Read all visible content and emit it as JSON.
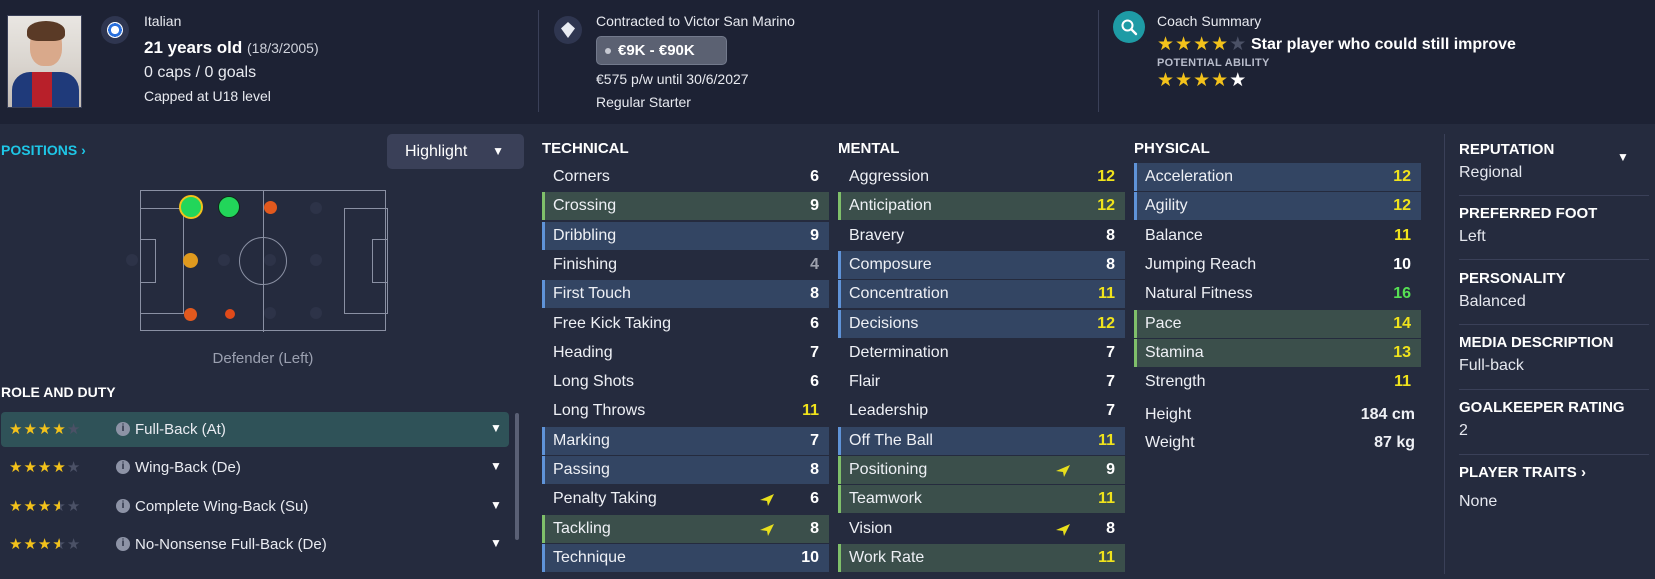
{
  "header": {
    "nationality": "Italian",
    "age": "21 years old",
    "dob": "(18/3/2005)",
    "caps": "0 caps / 0 goals",
    "capped_level": "Capped at U18 level",
    "contract_club": "Contracted to Victor San Marino",
    "wage_range": "€9K - €90K",
    "wage_detail": "€575 p/w until 30/6/2027",
    "squad_status": "Regular Starter",
    "coach_summary_title": "Coach Summary",
    "coach_summary_text": "Star player who could still improve",
    "current_ability_stars": 4,
    "potential_label": "POTENTIAL ABILITY",
    "potential_ability_stars": 4.5
  },
  "positions": {
    "link_label": "POSITIONS",
    "highlight_label": "Highlight",
    "caption": "Defender (Left)"
  },
  "roles": {
    "title": "ROLE AND DUTY",
    "items": [
      {
        "name": "Full-Back (At)",
        "stars": 4
      },
      {
        "name": "Wing-Back (De)",
        "stars": 4
      },
      {
        "name": "Complete Wing-Back (Su)",
        "stars": 3.5
      },
      {
        "name": "No-Nonsense Full-Back (De)",
        "stars": 3.5
      }
    ]
  },
  "technical": {
    "title": "TECHNICAL",
    "items": [
      {
        "name": "Corners",
        "value": "6"
      },
      {
        "name": "Crossing",
        "value": "9"
      },
      {
        "name": "Dribbling",
        "value": "9"
      },
      {
        "name": "Finishing",
        "value": "4"
      },
      {
        "name": "First Touch",
        "value": "8"
      },
      {
        "name": "Free Kick Taking",
        "value": "6"
      },
      {
        "name": "Heading",
        "value": "7"
      },
      {
        "name": "Long Shots",
        "value": "6"
      },
      {
        "name": "Long Throws",
        "value": "11"
      },
      {
        "name": "Marking",
        "value": "7"
      },
      {
        "name": "Passing",
        "value": "8"
      },
      {
        "name": "Penalty Taking",
        "value": "6"
      },
      {
        "name": "Tackling",
        "value": "8"
      },
      {
        "name": "Technique",
        "value": "10"
      }
    ]
  },
  "mental": {
    "title": "MENTAL",
    "items": [
      {
        "name": "Aggression",
        "value": "12"
      },
      {
        "name": "Anticipation",
        "value": "12"
      },
      {
        "name": "Bravery",
        "value": "8"
      },
      {
        "name": "Composure",
        "value": "8"
      },
      {
        "name": "Concentration",
        "value": "11"
      },
      {
        "name": "Decisions",
        "value": "12"
      },
      {
        "name": "Determination",
        "value": "7"
      },
      {
        "name": "Flair",
        "value": "7"
      },
      {
        "name": "Leadership",
        "value": "7"
      },
      {
        "name": "Off The Ball",
        "value": "11"
      },
      {
        "name": "Positioning",
        "value": "9"
      },
      {
        "name": "Teamwork",
        "value": "11"
      },
      {
        "name": "Vision",
        "value": "8"
      },
      {
        "name": "Work Rate",
        "value": "11"
      }
    ]
  },
  "physical": {
    "title": "PHYSICAL",
    "items": [
      {
        "name": "Acceleration",
        "value": "12"
      },
      {
        "name": "Agility",
        "value": "12"
      },
      {
        "name": "Balance",
        "value": "11"
      },
      {
        "name": "Jumping Reach",
        "value": "10"
      },
      {
        "name": "Natural Fitness",
        "value": "16"
      },
      {
        "name": "Pace",
        "value": "14"
      },
      {
        "name": "Stamina",
        "value": "13"
      },
      {
        "name": "Strength",
        "value": "11"
      }
    ],
    "height_label": "Height",
    "height_value": "184 cm",
    "weight_label": "Weight",
    "weight_value": "87 kg"
  },
  "info": {
    "reputation_label": "REPUTATION",
    "reputation_value": "Regional",
    "foot_label": "PREFERRED FOOT",
    "foot_value": "Left",
    "personality_label": "PERSONALITY",
    "personality_value": "Balanced",
    "media_label": "MEDIA DESCRIPTION",
    "media_value": "Full-back",
    "gk_label": "GOALKEEPER RATING",
    "gk_value": "2",
    "traits_label": "PLAYER TRAITS",
    "traits_value": "None"
  },
  "colors": {
    "accent_cyan": "#1ec6e6",
    "star_gold": "#f3c21b",
    "value_yellow": "#f0e31c",
    "value_green": "#56e053",
    "highlight_blue": "#334563",
    "highlight_green": "#3b4f4b"
  }
}
